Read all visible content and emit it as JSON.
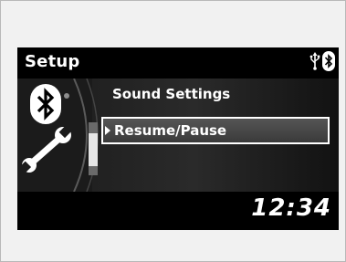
{
  "header": {
    "title": "Setup",
    "icons": [
      "usb-icon",
      "bluetooth-icon"
    ]
  },
  "sidebar": {
    "icons": [
      "bluetooth-icon",
      "wrench-icon"
    ]
  },
  "menu": {
    "items": [
      {
        "label": "Sound Settings",
        "selected": false
      },
      {
        "label": "Resume/Pause",
        "selected": true
      }
    ],
    "scroll_position": 0.5
  },
  "footer": {
    "clock": "12:34"
  },
  "colors": {
    "screen_background": "#000000",
    "text": "#ffffff",
    "highlight_border": "#ffffff",
    "bezel": "#f1f1f1"
  }
}
